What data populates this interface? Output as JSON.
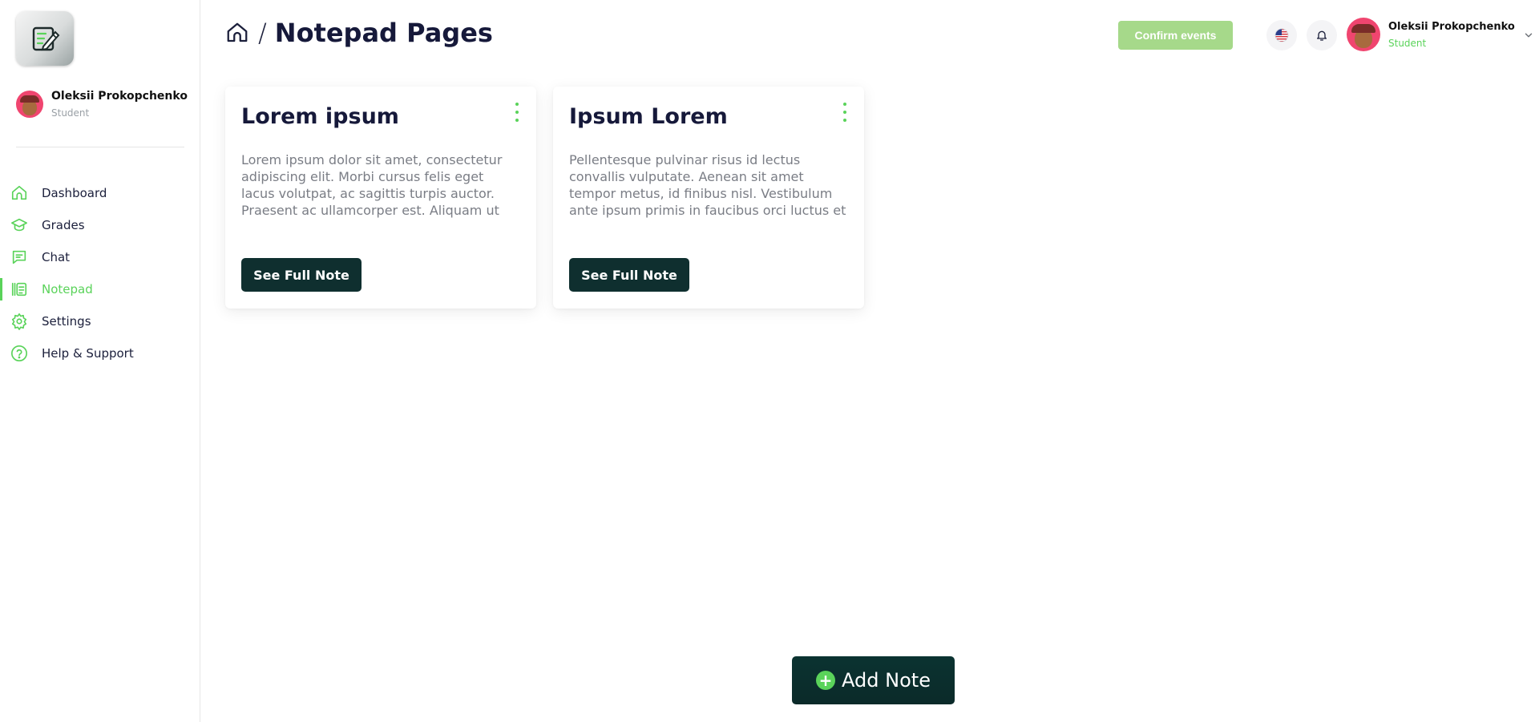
{
  "sidebar": {
    "logo_icon": "notepad-pen-icon",
    "user": {
      "name": "Oleksii Prokopchenko",
      "role": "Student"
    },
    "items": [
      {
        "label": "Dashboard",
        "icon": "home-icon",
        "active": false
      },
      {
        "label": "Grades",
        "icon": "graduation-cap-icon",
        "active": false
      },
      {
        "label": "Chat",
        "icon": "chat-icon",
        "active": false
      },
      {
        "label": "Notepad",
        "icon": "notepad-icon",
        "active": true
      },
      {
        "label": "Settings",
        "icon": "gear-icon",
        "active": false
      },
      {
        "label": "Help & Support",
        "icon": "help-icon",
        "active": false
      }
    ]
  },
  "header": {
    "breadcrumb_separator": "/",
    "title": "Notepad Pages",
    "confirm_label": "Confirm events",
    "user": {
      "name": "Oleksii Prokopchenko",
      "role": "Student"
    }
  },
  "notes": [
    {
      "title": "Lorem ipsum",
      "excerpt": "Lorem ipsum dolor sit amet, consectetur adipiscing elit. Morbi cursus felis eget lacus volutpat, ac sagittis turpis auctor. Praesent ac ullamcorper est. Aliquam ut justo dictum, blandit lectus nec,...",
      "button_label": "See Full Note"
    },
    {
      "title": "Ipsum Lorem",
      "excerpt": "Pellentesque pulvinar risus id lectus convallis vulputate. Aenean sit amet tempor metus, id finibus nisl. Vestibulum ante ipsum primis in faucibus orci luctus et ultrices posuere cubilia curae; Integer...",
      "button_label": "See Full Note"
    }
  ],
  "add_note": {
    "label": "Add Note"
  },
  "colors": {
    "accent": "#5ad35a",
    "dark_button": "#0f2f2f",
    "confirm_button": "#a6d98a",
    "avatar_bg": "#f0456f"
  }
}
